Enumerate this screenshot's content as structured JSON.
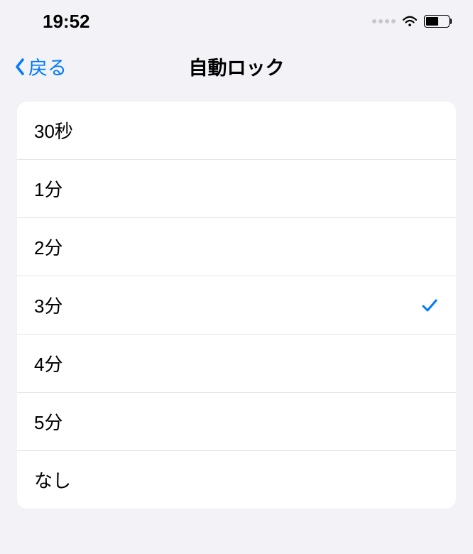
{
  "status": {
    "time": "19:52"
  },
  "nav": {
    "back_label": "戻る",
    "title": "自動ロック"
  },
  "options": [
    {
      "label": "30秒",
      "selected": false
    },
    {
      "label": "1分",
      "selected": false
    },
    {
      "label": "2分",
      "selected": false
    },
    {
      "label": "3分",
      "selected": true
    },
    {
      "label": "4分",
      "selected": false
    },
    {
      "label": "5分",
      "selected": false
    },
    {
      "label": "なし",
      "selected": false
    }
  ]
}
